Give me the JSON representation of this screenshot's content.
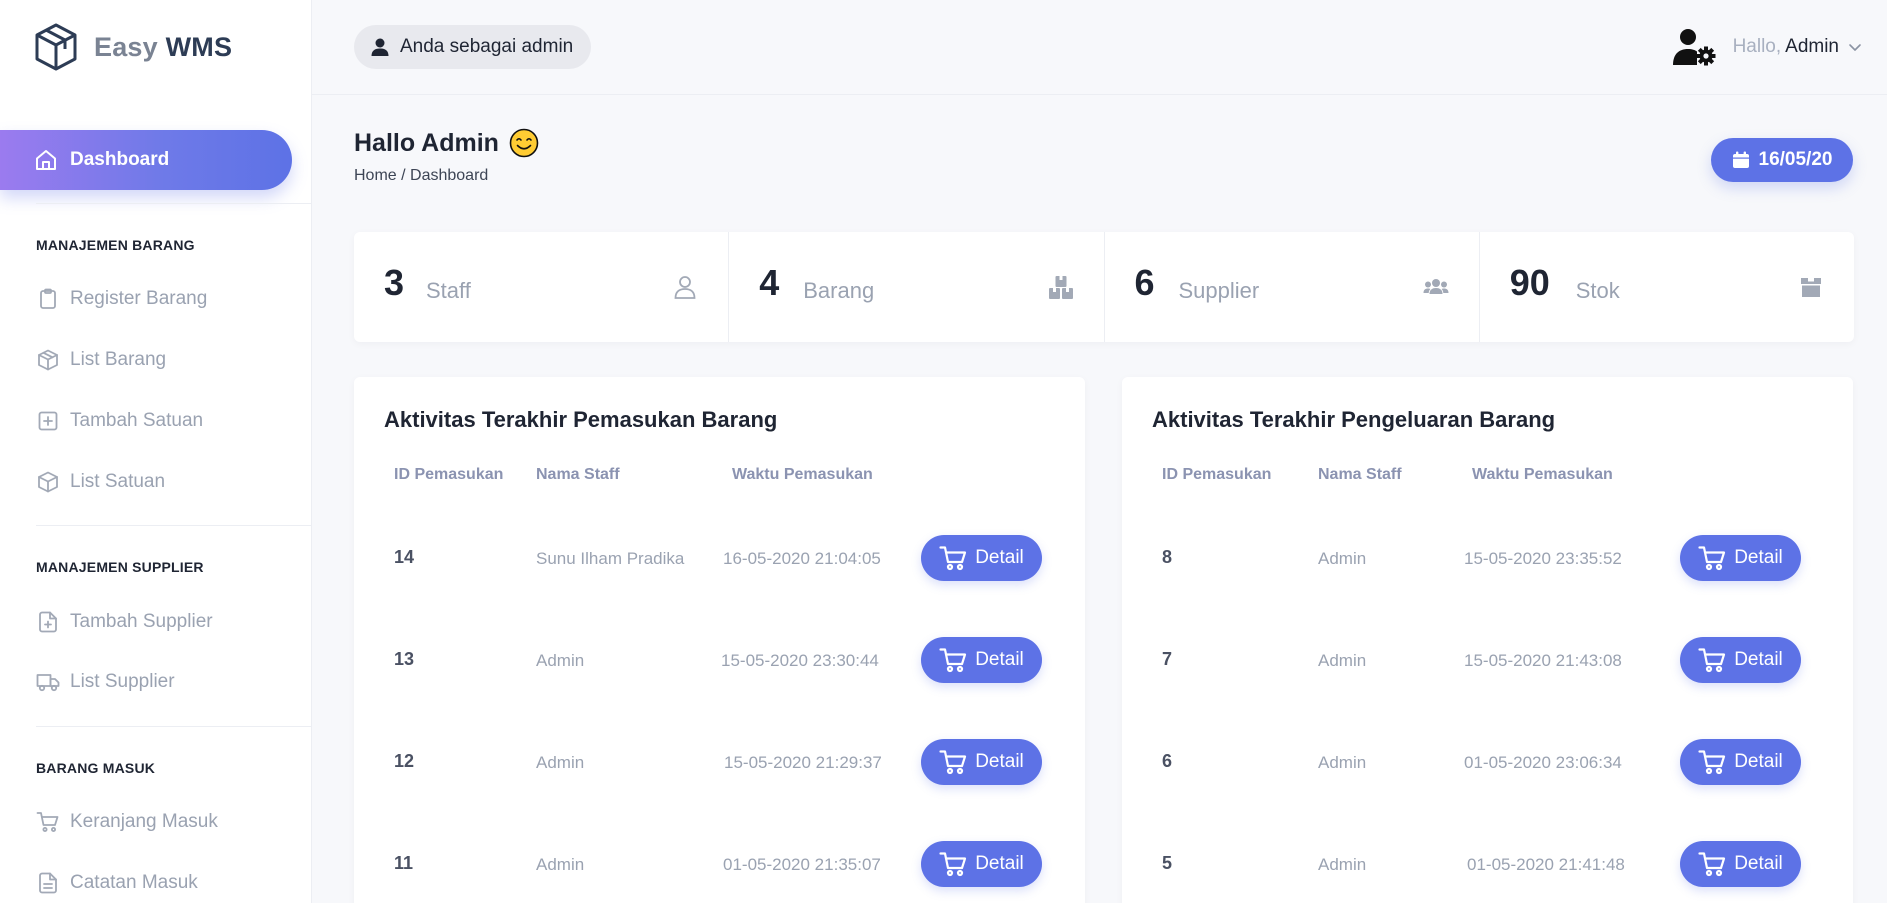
{
  "brand": {
    "name_part1": "Easy",
    "name_part2": "WMS"
  },
  "sidebar": {
    "active": {
      "label": "Dashboard",
      "icon": "home-icon"
    },
    "sections": [
      {
        "title": "MANAJEMEN BARANG",
        "items": [
          {
            "label": "Register Barang",
            "icon": "clipboard-icon"
          },
          {
            "label": "List Barang",
            "icon": "box-icon"
          },
          {
            "label": "Tambah Satuan",
            "icon": "plus-square-icon"
          },
          {
            "label": "List Satuan",
            "icon": "box-icon"
          }
        ]
      },
      {
        "title": "MANAJEMEN SUPPLIER",
        "items": [
          {
            "label": "Tambah Supplier",
            "icon": "file-plus-icon"
          },
          {
            "label": "List Supplier",
            "icon": "truck-icon"
          }
        ]
      },
      {
        "title": "BARANG MASUK",
        "items": [
          {
            "label": "Keranjang Masuk",
            "icon": "cart-icon"
          },
          {
            "label": "Catatan Masuk",
            "icon": "file-text-icon"
          }
        ]
      }
    ]
  },
  "topbar": {
    "role_label": "Anda sebagai admin",
    "hello": "Hallo,",
    "user_name": "Admin"
  },
  "page": {
    "title": "Hallo Admin",
    "breadcrumb": "Home / Dashboard",
    "date": "16/05/20"
  },
  "stats": [
    {
      "value": "3",
      "label": "Staff",
      "icon": "user-icon"
    },
    {
      "value": "4",
      "label": "Barang",
      "icon": "boxes-icon"
    },
    {
      "value": "6",
      "label": "Supplier",
      "icon": "users-icon"
    },
    {
      "value": "90",
      "label": "Stok",
      "icon": "archive-icon"
    }
  ],
  "incoming": {
    "title": "Aktivitas Terakhir Pemasukan Barang",
    "headers": [
      "ID Pemasukan",
      "Nama Staff",
      "Waktu Pemasukan"
    ],
    "detail_label": "Detail",
    "rows": [
      {
        "id": "14",
        "staff": "Sunu Ilham Pradika",
        "time": "16-05-2020 21:04:05"
      },
      {
        "id": "13",
        "staff": "Admin",
        "time": "15-05-2020 23:30:44"
      },
      {
        "id": "12",
        "staff": "Admin",
        "time": "15-05-2020 21:29:37"
      },
      {
        "id": "11",
        "staff": "Admin",
        "time": "01-05-2020 21:35:07"
      }
    ]
  },
  "outgoing": {
    "title": "Aktivitas Terakhir Pengeluaran Barang",
    "headers": [
      "ID Pemasukan",
      "Nama Staff",
      "Waktu Pemasukan"
    ],
    "detail_label": "Detail",
    "rows": [
      {
        "id": "8",
        "staff": "Admin",
        "time": "15-05-2020 23:35:52"
      },
      {
        "id": "7",
        "staff": "Admin",
        "time": "15-05-2020 21:43:08"
      },
      {
        "id": "6",
        "staff": "Admin",
        "time": "01-05-2020 23:06:34"
      },
      {
        "id": "5",
        "staff": "Admin",
        "time": "01-05-2020 21:41:48"
      }
    ]
  },
  "colors": {
    "accent": "#5d72e6",
    "accent_gradient_start": "#9b7bef",
    "muted": "#9aa2b1",
    "background": "#f7f8fb"
  }
}
